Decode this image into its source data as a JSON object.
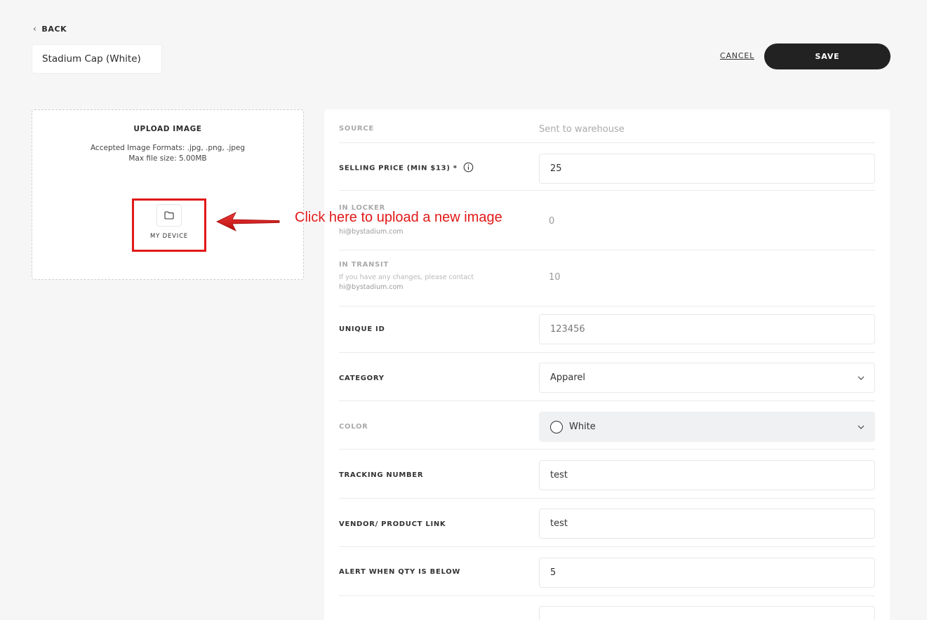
{
  "header": {
    "back_label": "BACK",
    "product_name": "Stadium Cap (White)",
    "cancel_label": "CANCEL",
    "save_label": "SAVE"
  },
  "upload": {
    "title": "UPLOAD IMAGE",
    "formats": "Accepted Image Formats: .jpg, .png, .jpeg",
    "max_size": "Max file size: 5.00MB",
    "device_label": "MY DEVICE",
    "device_icon": "folder-icon"
  },
  "annotation": {
    "text": "Click here to upload a new image",
    "color": "#e11818"
  },
  "form": {
    "source": {
      "label": "SOURCE",
      "value": "Sent to warehouse"
    },
    "selling_price": {
      "label": "SELLING PRICE (MIN $13) *",
      "value": "25",
      "icon": "info-icon"
    },
    "in_locker": {
      "label": "IN LOCKER",
      "sub_email": "hi@bystadium.com",
      "value": "0"
    },
    "in_transit": {
      "label": "IN TRANSIT",
      "sub_text": "If you have any changes, please contact",
      "sub_email": "hi@bystadium.com",
      "value": "10"
    },
    "unique_id": {
      "label": "UNIQUE ID",
      "value": "123456"
    },
    "category": {
      "label": "CATEGORY",
      "value": "Apparel"
    },
    "color": {
      "label": "COLOR",
      "value": "White",
      "swatch": "#ffffff"
    },
    "tracking_number": {
      "label": "TRACKING NUMBER",
      "value": "test"
    },
    "vendor_link": {
      "label": "VENDOR/ PRODUCT LINK",
      "value": "test"
    },
    "alert_qty": {
      "label": "ALERT WHEN QTY IS BELOW",
      "value": "5"
    }
  },
  "colors": {
    "primary_button": "#222222",
    "annotation_red": "#e11818",
    "background": "#f6f6f6"
  }
}
